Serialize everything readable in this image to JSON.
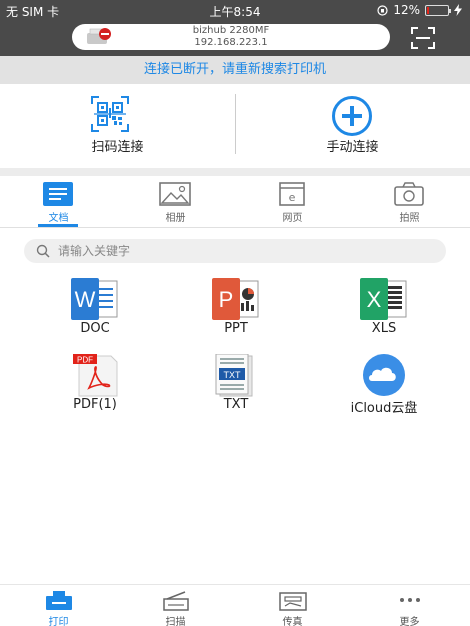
{
  "status_bar": {
    "carrier": "无 SIM 卡",
    "time": "上午8:54",
    "battery": "12%",
    "battery_level": 0.12,
    "battery_color": "#e2231a"
  },
  "printer": {
    "name": "bizhub 2280MF",
    "ip": "192.168.223.1"
  },
  "banner": {
    "message": "连接已断开，请重新搜索打印机"
  },
  "connect": {
    "scan_label": "扫码连接",
    "manual_label": "手动连接"
  },
  "tabs": [
    {
      "label": "文档",
      "icon": "document-icon",
      "active": true
    },
    {
      "label": "相册",
      "icon": "photo-icon",
      "active": false
    },
    {
      "label": "网页",
      "icon": "webpage-icon",
      "active": false
    },
    {
      "label": "拍照",
      "icon": "camera-icon",
      "active": false
    }
  ],
  "search": {
    "placeholder": "请输入关键字",
    "value": ""
  },
  "files": [
    {
      "label": "DOC",
      "icon": "word-icon",
      "color": "#2b7cd3"
    },
    {
      "label": "PPT",
      "icon": "powerpoint-icon",
      "color": "#e0593a"
    },
    {
      "label": "XLS",
      "icon": "excel-icon",
      "color": "#21a366"
    },
    {
      "label": "PDF(1)",
      "icon": "pdf-icon",
      "color": "#e2231a"
    },
    {
      "label": "TXT",
      "icon": "txt-icon",
      "color": "#1e5aa8"
    },
    {
      "label": "iCloud云盘",
      "icon": "icloud-icon",
      "color": "#3a8ee6"
    }
  ],
  "tabbar": [
    {
      "label": "打印",
      "icon": "print-icon",
      "active": true
    },
    {
      "label": "扫描",
      "icon": "scan-icon",
      "active": false
    },
    {
      "label": "传真",
      "icon": "fax-icon",
      "active": false
    },
    {
      "label": "更多",
      "icon": "more-icon",
      "active": false
    }
  ],
  "colors": {
    "accent": "#1e88e5",
    "header": "#4a4a4a"
  }
}
